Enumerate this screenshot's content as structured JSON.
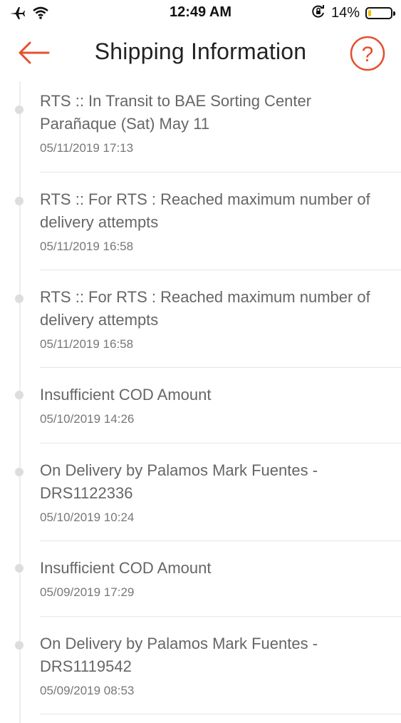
{
  "status_bar": {
    "time": "12:49 AM",
    "battery_percent": "14%",
    "icons": [
      "airplane-icon",
      "wifi-icon",
      "rotation-lock-icon",
      "battery-icon"
    ],
    "battery_level": 0.14,
    "battery_color": "#f2c200"
  },
  "nav": {
    "title": "Shipping Information",
    "back_icon": "arrow-left-icon",
    "help_icon": "question-circle-icon",
    "accent_color": "#e5502f"
  },
  "events": [
    {
      "description": "RTS :: In Transit to BAE Sorting Center Parañaque (Sat) May 11",
      "timestamp": "05/11/2019 17:13"
    },
    {
      "description": "RTS :: For RTS : Reached maximum number of delivery attempts",
      "timestamp": "05/11/2019 16:58"
    },
    {
      "description": "RTS :: For RTS : Reached maximum number of delivery attempts",
      "timestamp": "05/11/2019 16:58"
    },
    {
      "description": "Insufficient COD Amount",
      "timestamp": "05/10/2019 14:26"
    },
    {
      "description": "On Delivery by Palamos Mark Fuentes - DRS1122336",
      "timestamp": "05/10/2019 10:24"
    },
    {
      "description": "Insufficient COD Amount",
      "timestamp": "05/09/2019 17:29"
    },
    {
      "description": "On Delivery by Palamos Mark Fuentes - DRS1119542",
      "timestamp": "05/09/2019 08:53"
    }
  ]
}
